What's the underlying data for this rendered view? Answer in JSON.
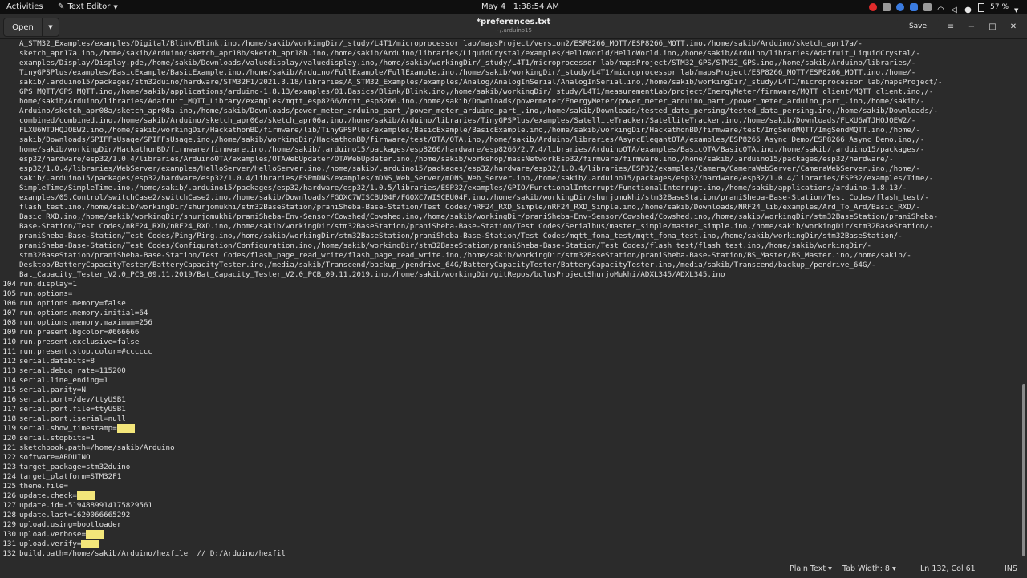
{
  "topbar": {
    "activities": "Activities",
    "app_name": "Text Editor",
    "clock_date": "May 4",
    "clock_time": "1:38:54 AM",
    "battery": "57 %"
  },
  "headerbar": {
    "open_label": "Open",
    "title": "*preferences.txt",
    "subtitle": "~/.arduino15",
    "save_label": "Save",
    "menu_icon": "≡",
    "minimize_icon": "−",
    "maximize_icon": "□",
    "close_icon": "✕"
  },
  "editor": {
    "wrapped_lines": [
      "A_STM32_Examples/examples/Digital/Blink/Blink.ino,/home/sakib/workingDir/_study/L4T1/microprocessor lab/mapsProject/version2/ESP8266_MQTT/ESP8266_MQTT.ino,/home/sakib/Arduino/sketch_apr17a/-",
      "sketch_apr17a.ino,/home/sakib/Arduino/sketch_apr18b/sketch_apr18b.ino,/home/sakib/Arduino/libraries/LiquidCrystal/examples/HelloWorld/HelloWorld.ino,/home/sakib/Arduino/libraries/Adafruit_LiquidCrystal/-",
      "examples/Display/Display.pde,/home/sakib/Downloads/valuedisplay/valuedisplay.ino,/home/sakib/workingDir/_study/L4T1/microprocessor lab/mapsProject/STM32_GPS/STM32_GPS.ino,/home/sakib/Arduino/libraries/-",
      "TinyGPSPlus/examples/BasicExample/BasicExample.ino,/home/sakib/Arduino/FullExample/FullExample.ino,/home/sakib/workingDir/_study/L4T1/microprocessor lab/mapsProject/ESP8266_MQTT/ESP8266_MQTT.ino,/home/-",
      "sakib/.arduino15/packages/stm32duino/hardware/STM32F1/2021.3.18/libraries/A_STM32_Examples/examples/Analog/AnalogInSerial/AnalogInSerial.ino,/home/sakib/workingDir/_study/L4T1/microprocessor lab/mapsProject/-",
      "GPS_MQTT/GPS_MQTT.ino,/home/sakib/applications/arduino-1.8.13/examples/01.Basics/Blink/Blink.ino,/home/sakib/workingDir/_study/L4T1/measurementLab/project/EnergyMeter/firmware/MQTT_client/MQTT_client.ino,/-",
      "home/sakib/Arduino/libraries/Adafruit_MQTT_Library/examples/mqtt_esp8266/mqtt_esp8266.ino,/home/sakib/Downloads/powermeter/EnergyMeter/power_meter_arduino_part_/power_meter_arduino_part_.ino,/home/sakib/-",
      "Arduino/sketch_apr08a/sketch_apr08a.ino,/home/sakib/Downloads/power_meter_arduino_part_/power_meter_arduino_part_.ino,/home/sakib/Downloads/tested_data_persing/tested_data_persing.ino,/home/sakib/Downloads/-",
      "combined/combined.ino,/home/sakib/Arduino/sketch_apr06a/sketch_apr06a.ino,/home/sakib/Arduino/libraries/TinyGPSPlus/examples/SatelliteTracker/SatelliteTracker.ino,/home/sakib/Downloads/FLXU6WTJHQJOEW2/-",
      "FLXU6WTJHQJOEW2.ino,/home/sakib/workingDir/HackathonBD/firmware/lib/TinyGPSPlus/examples/BasicExample/BasicExample.ino,/home/sakib/workingDir/HackathonBD/firmware/test/ImgSendMQTT/ImgSendMQTT.ino,/home/-",
      "sakib/Downloads/SPIFFsUsage/SPIFFsUsage.ino,/home/sakib/workingDir/HackathonBD/firmware/test/OTA/OTA.ino,/home/sakib/Arduino/libraries/AsyncElegantOTA/examples/ESP8266_Async_Demo/ESP8266_Async_Demo.ino,/-",
      "home/sakib/workingDir/HackathonBD/firmware/firmware.ino,/home/sakib/.arduino15/packages/esp8266/hardware/esp8266/2.7.4/libraries/ArduinoOTA/examples/BasicOTA/BasicOTA.ino,/home/sakib/.arduino15/packages/-",
      "esp32/hardware/esp32/1.0.4/libraries/ArduinoOTA/examples/OTAWebUpdater/OTAWebUpdater.ino,/home/sakib/workshop/massNetworkEsp32/firmware/firmware.ino,/home/sakib/.arduino15/packages/esp32/hardware/-",
      "esp32/1.0.4/libraries/WebServer/examples/HelloServer/HelloServer.ino,/home/sakib/.arduino15/packages/esp32/hardware/esp32/1.0.4/libraries/ESP32/examples/Camera/CameraWebServer/CameraWebServer.ino,/home/-",
      "sakib/.arduino15/packages/esp32/hardware/esp32/1.0.4/libraries/ESPmDNS/examples/mDNS_Web_Server/mDNS_Web_Server.ino,/home/sakib/.arduino15/packages/esp32/hardware/esp32/1.0.4/libraries/ESP32/examples/Time/-",
      "SimpleTime/SimpleTime.ino,/home/sakib/.arduino15/packages/esp32/hardware/esp32/1.0.5/libraries/ESP32/examples/GPIO/FunctionalInterrupt/FunctionalInterrupt.ino,/home/sakib/applications/arduino-1.8.13/-",
      "examples/05.Control/switchCase2/switchCase2.ino,/home/sakib/Downloads/FGQXC7WISCBU04F/FGQXC7WISCBU04F.ino,/home/sakib/workingDir/shurjomukhi/stm32BaseStation/praniSheba-Base-Station/Test Codes/flash_test/-",
      "flash_test.ino,/home/sakib/workingDir/shurjomukhi/stm32BaseStation/praniSheba-Base-Station/Test Codes/nRF24_RXD_Simple/nRF24_RXD_Simple.ino,/home/sakib/Downloads/NRF24_lib/examples/Ard_To_Ard/Basic_RXD/-",
      "Basic_RXD.ino,/home/sakib/workingDir/shurjomukhi/praniSheba-Env-Sensor/Cowshed/Cowshed.ino,/home/sakib/workingDir/praniSheba-Env-Sensor/Cowshed/Cowshed.ino,/home/sakib/workingDir/stm32BaseStation/praniSheba-",
      "Base-Station/Test Codes/nRF24_RXD/nRF24_RXD.ino,/home/sakib/workingDir/stm32BaseStation/praniSheba-Base-Station/Test Codes/Serialbus/master_simple/master_simple.ino,/home/sakib/workingDir/stm32BaseStation/-",
      "praniSheba-Base-Station/Test Codes/Ping/Ping.ino,/home/sakib/workingDir/stm32BaseStation/praniSheba-Base-Station/Test Codes/mqtt_fona_test/mqtt_fona_test.ino,/home/sakib/workingDir/stm32BaseStation/-",
      "praniSheba-Base-Station/Test Codes/Configuration/Configuration.ino,/home/sakib/workingDir/stm32BaseStation/praniSheba-Base-Station/Test Codes/flash_test/flash_test.ino,/home/sakib/workingDir/-",
      "stm32BaseStation/praniSheba-Base-Station/Test Codes/flash_page_read_write/flash_page_read_write.ino,/home/sakib/workingDir/stm32BaseStation/praniSheba-Base-Station/BS_Master/BS_Master.ino,/home/sakib/-",
      "Desktop/BatteryCapacityTester/BatteryCapacityTester.ino,/media/sakib/Transcend/backup_/pendrive_64G/BatteryCapacityTester/BatteryCapacityTester.ino,/media/sakib/Transcend/backup_/pendrive_64G/-",
      "Bat_Capacity_Tester_V2.0_PCB_09.11.2019/Bat_Capacity_Tester_V2.0_PCB_09.11.2019.ino,/home/sakib/workingDir/gitRepos/bolusProjectShurjoMukhi/ADXL345/ADXL345.ino"
    ],
    "numbered_lines": [
      {
        "num": "104",
        "text": "run.display=1",
        "hl": ""
      },
      {
        "num": "105",
        "text": "run.options=",
        "hl": ""
      },
      {
        "num": "106",
        "text": "run.options.memory=false",
        "hl": ""
      },
      {
        "num": "107",
        "text": "run.options.memory.initial=64",
        "hl": ""
      },
      {
        "num": "108",
        "text": "run.options.memory.maximum=256",
        "hl": ""
      },
      {
        "num": "109",
        "text": "run.present.bgcolor=#666666",
        "hl": ""
      },
      {
        "num": "110",
        "text": "run.present.exclusive=false",
        "hl": ""
      },
      {
        "num": "111",
        "text": "run.present.stop.color=#cccccc",
        "hl": ""
      },
      {
        "num": "112",
        "text": "serial.databits=8",
        "hl": ""
      },
      {
        "num": "113",
        "text": "serial.debug_rate=115200",
        "hl": ""
      },
      {
        "num": "114",
        "text": "serial.line_ending=1",
        "hl": ""
      },
      {
        "num": "115",
        "text": "serial.parity=N",
        "hl": ""
      },
      {
        "num": "116",
        "text": "serial.port=/dev/ttyUSB1",
        "hl": ""
      },
      {
        "num": "117",
        "text": "serial.port.file=ttyUSB1",
        "hl": ""
      },
      {
        "num": "118",
        "text": "serial.port.iserial=null",
        "hl": ""
      },
      {
        "num": "119",
        "text": "serial.show_timestamp=",
        "hl": "true"
      },
      {
        "num": "120",
        "text": "serial.stopbits=1",
        "hl": ""
      },
      {
        "num": "121",
        "text": "sketchbook.path=/home/sakib/Arduino",
        "hl": ""
      },
      {
        "num": "122",
        "text": "software=ARDUINO",
        "hl": ""
      },
      {
        "num": "123",
        "text": "target_package=stm32duino",
        "hl": ""
      },
      {
        "num": "124",
        "text": "target_platform=STM32F1",
        "hl": ""
      },
      {
        "num": "125",
        "text": "theme.file=",
        "hl": ""
      },
      {
        "num": "126",
        "text": "update.check=",
        "hl": "true"
      },
      {
        "num": "127",
        "text": "update.id=-5194889914175829561",
        "hl": ""
      },
      {
        "num": "128",
        "text": "update.last=1620066665292",
        "hl": ""
      },
      {
        "num": "129",
        "text": "upload.using=bootloader",
        "hl": ""
      },
      {
        "num": "130",
        "text": "upload.verbose=",
        "hl": "true"
      },
      {
        "num": "131",
        "text": "upload.verify=",
        "hl": "true"
      },
      {
        "num": "132",
        "text": "build.path=/home/sakib/Arduino/hexfile  // D:/Arduino/hexfil",
        "hl": ""
      }
    ],
    "highlight_color": "#f3e67a"
  },
  "statusbar": {
    "language": "Plain Text ▾",
    "tab_width": "Tab Width: 8 ▾",
    "cursor_pos": "Ln 132, Col 61",
    "mode": "INS"
  }
}
